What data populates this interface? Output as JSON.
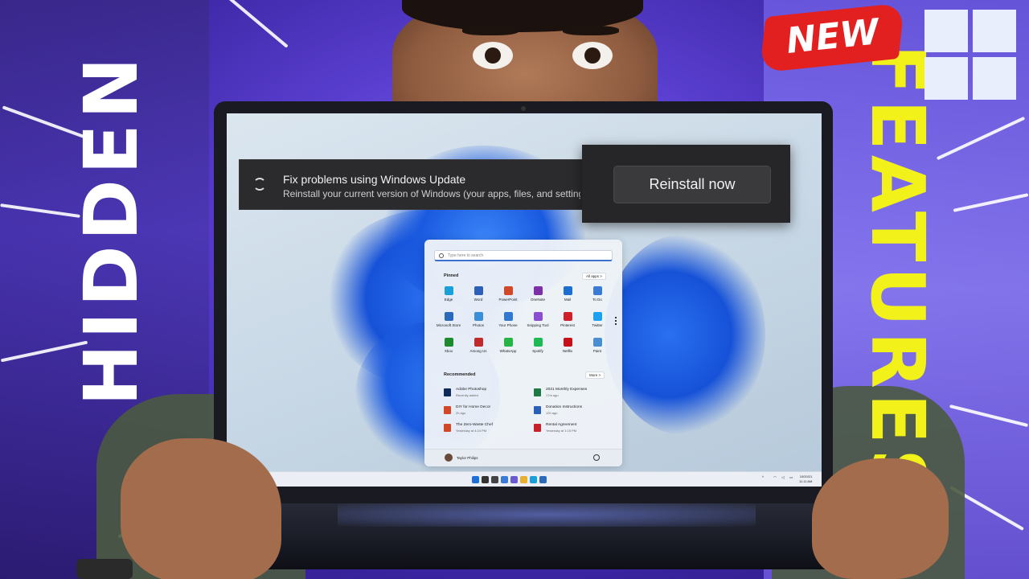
{
  "thumbnail": {
    "left_title": "HIDDEN",
    "right_title": "FEATURES",
    "badge": "NEW",
    "colors": {
      "left_title": "#ffffff",
      "right_title": "#f2f21a",
      "badge": "#e22020",
      "background": "#5a3fd0"
    }
  },
  "notification": {
    "icon": "sync-icon",
    "title": "Fix problems using Windows Update",
    "description": "Reinstall your current version of Windows (your apps, files, and settings",
    "button_label": "Reinstall now"
  },
  "start_menu": {
    "search_placeholder": "Type here to search",
    "pinned_title": "Pinned",
    "all_apps_label": "All apps >",
    "pinned_apps": [
      {
        "label": "Edge",
        "icon": "edge-icon",
        "color": "#1aa0d8"
      },
      {
        "label": "Word",
        "icon": "word-icon",
        "color": "#2b5fb8"
      },
      {
        "label": "PowerPoint",
        "icon": "powerpoint-icon",
        "color": "#d24726"
      },
      {
        "label": "OneNote",
        "icon": "onenote-icon",
        "color": "#7b2fa8"
      },
      {
        "label": "Mail",
        "icon": "mail-icon",
        "color": "#1b6fd0"
      },
      {
        "label": "To Do",
        "icon": "todo-icon",
        "color": "#3a7bd5"
      },
      {
        "label": "Microsoft Store",
        "icon": "store-icon",
        "color": "#2a6ab8"
      },
      {
        "label": "Photos",
        "icon": "photos-icon",
        "color": "#3a8fd8"
      },
      {
        "label": "Your Phone",
        "icon": "phone-icon",
        "color": "#2f7ad0"
      },
      {
        "label": "Snipping Tool",
        "icon": "snipping-icon",
        "color": "#8a4fd0"
      },
      {
        "label": "Pinterest",
        "icon": "pinterest-icon",
        "color": "#d0202a"
      },
      {
        "label": "Twitter",
        "icon": "twitter-icon",
        "color": "#1da1f2"
      },
      {
        "label": "Xbox",
        "icon": "xbox-icon",
        "color": "#1e8a2e"
      },
      {
        "label": "Among Us",
        "icon": "among-us-icon",
        "color": "#c02a2a"
      },
      {
        "label": "WhatsApp",
        "icon": "whatsapp-icon",
        "color": "#25b545"
      },
      {
        "label": "Spotify",
        "icon": "spotify-icon",
        "color": "#1db954"
      },
      {
        "label": "Netflix",
        "icon": "netflix-icon",
        "color": "#c8101a"
      },
      {
        "label": "Paint",
        "icon": "paint-icon",
        "color": "#4a90d0"
      }
    ],
    "recommended_title": "Recommended",
    "more_label": "More >",
    "recommended": [
      {
        "title": "Adobe Photoshop",
        "sub": "Recently added",
        "icon": "photoshop-icon",
        "color": "#0e2a58"
      },
      {
        "title": "2021 Monthly Expenses",
        "sub": "17m ago",
        "icon": "excel-icon",
        "color": "#1e7a44"
      },
      {
        "title": "DIY for Home Decor",
        "sub": "2h ago",
        "icon": "powerpoint-file-icon",
        "color": "#d24726"
      },
      {
        "title": "Donation Instructions",
        "sub": "12h ago",
        "icon": "word-file-icon",
        "color": "#2b5fb8"
      },
      {
        "title": "The Zero-Waste Chef",
        "sub": "Yesterday at 4:24 PM",
        "icon": "powerpoint-file-icon",
        "color": "#d24726"
      },
      {
        "title": "Rental Agreement",
        "sub": "Yesterday at 1:15 PM",
        "icon": "pdf-icon",
        "color": "#c8202a"
      }
    ],
    "user_name": "Taylor Philips"
  },
  "taskbar": {
    "icons": [
      {
        "icon": "windows-start-icon",
        "color": "#1f6fd8"
      },
      {
        "icon": "search-icon",
        "color": "#333333"
      },
      {
        "icon": "task-view-icon",
        "color": "#444444"
      },
      {
        "icon": "widgets-icon",
        "color": "#3a7bd5"
      },
      {
        "icon": "chat-icon",
        "color": "#6a5ad0"
      },
      {
        "icon": "file-explorer-icon",
        "color": "#e8b030"
      },
      {
        "icon": "edge-icon",
        "color": "#1aa0d8"
      },
      {
        "icon": "store-icon",
        "color": "#2a6ab8"
      }
    ],
    "date": "10/20/21",
    "time": "11:11 AM"
  }
}
